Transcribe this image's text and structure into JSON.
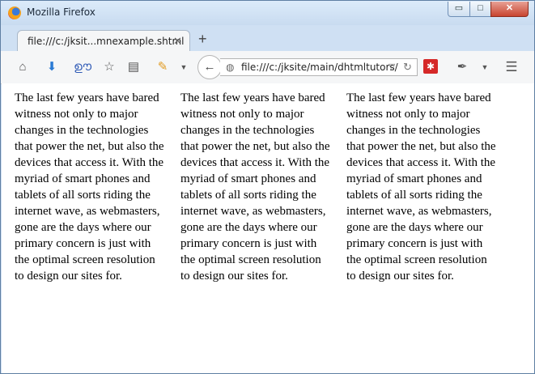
{
  "window": {
    "title": "Mozilla Firefox",
    "controls": {
      "minimize": "▭",
      "maximize": "□",
      "close": "✕"
    }
  },
  "tabs": [
    {
      "label": "file:///c:/jksit...mnexample.shtml",
      "close": "✕"
    }
  ],
  "new_tab": "+",
  "toolbar": {
    "back": "←",
    "url": "file:///c:/jksite/main/dhtmltutors/",
    "icons": [
      "home-icon",
      "download-icon",
      "extension-icon",
      "bookmark-star-icon",
      "reading-list-icon",
      "pencil-icon",
      "back-arrow-icon",
      "globe-icon",
      "reload-icon",
      "addon-icon",
      "eyedropper-icon",
      "hamburger-menu-icon"
    ]
  },
  "content": {
    "columns": [
      "The last few years have bared witness not only to major changes in the technologies that power the net, but also the devices that access it. With the myriad of smart phones and tablets of all sorts riding the internet wave, as webmasters, gone are the days where our primary concern is just with the optimal screen resolution to design our sites for.",
      "The last few years have bared witness not only to major changes in the technologies that power the net, but also the devices that access it. With the myriad of smart phones and tablets of all sorts riding the internet wave, as webmasters, gone are the days where our primary concern is just with the optimal screen resolution to design our sites for.",
      "The last few years have bared witness not only to major changes in the technologies that power the net, but also the devices that access it. With the myriad of smart phones and tablets of all sorts riding the internet wave, as webmasters, gone are the days where our primary concern is just with the optimal screen resolution to design our sites for."
    ]
  }
}
